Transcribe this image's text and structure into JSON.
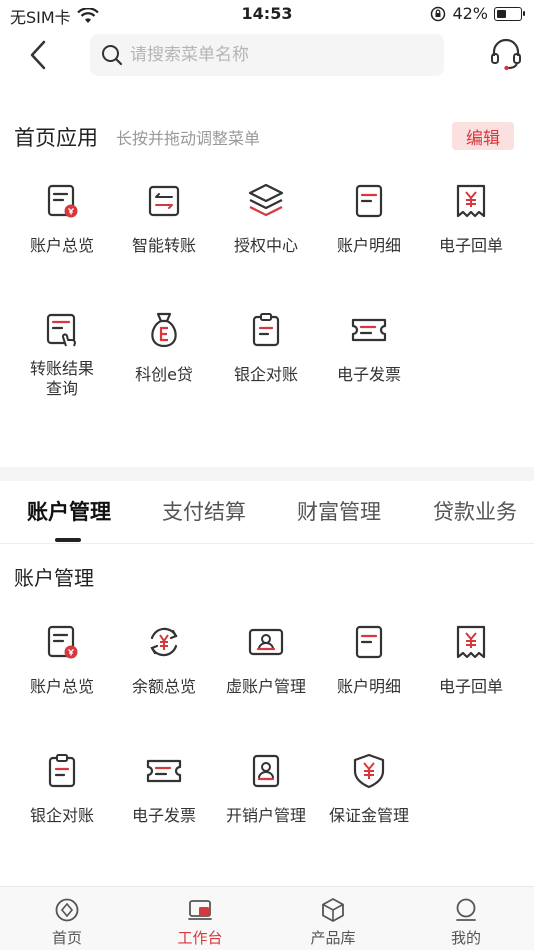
{
  "status_bar": {
    "carrier": "无SIM卡",
    "time": "14:53",
    "battery": "42%",
    "battery_level": 0.42
  },
  "search": {
    "placeholder": "请搜索菜单名称"
  },
  "home_apps": {
    "title": "首页应用",
    "hint": "长按并拖动调整菜单",
    "edit_label": "编辑",
    "items": [
      {
        "label": "账户总览",
        "icon": "account-overview-icon"
      },
      {
        "label": "智能转账",
        "icon": "smart-transfer-icon"
      },
      {
        "label": "授权中心",
        "icon": "layers-icon"
      },
      {
        "label": "账户明细",
        "icon": "account-detail-icon"
      },
      {
        "label": "电子回单",
        "icon": "receipt-icon"
      },
      {
        "label": "转账结果查询",
        "line1": "转账结果",
        "line2": "查询",
        "icon": "transfer-query-icon"
      },
      {
        "label": "科创e贷",
        "icon": "money-bag-icon"
      },
      {
        "label": "银企对账",
        "icon": "clipboard-icon"
      },
      {
        "label": "电子发票",
        "icon": "ticket-icon"
      }
    ]
  },
  "tabs": {
    "items": [
      "账户管理",
      "支付结算",
      "财富管理",
      "贷款业务"
    ],
    "active": "账户管理"
  },
  "account_mgmt": {
    "title": "账户管理",
    "items": [
      {
        "label": "账户总览",
        "icon": "account-overview-icon"
      },
      {
        "label": "余额总览",
        "icon": "balance-cycle-icon"
      },
      {
        "label": "虚账户管理",
        "icon": "virtual-account-icon"
      },
      {
        "label": "账户明细",
        "icon": "account-detail-icon"
      },
      {
        "label": "电子回单",
        "icon": "receipt-icon"
      },
      {
        "label": "银企对账",
        "icon": "clipboard-icon"
      },
      {
        "label": "电子发票",
        "icon": "ticket-icon"
      },
      {
        "label": "开销户管理",
        "icon": "id-card-icon"
      },
      {
        "label": "保证金管理",
        "icon": "shield-yen-icon"
      }
    ]
  },
  "tabbar": {
    "items": [
      {
        "label": "首页",
        "icon": "home-icon"
      },
      {
        "label": "工作台",
        "icon": "workbench-icon"
      },
      {
        "label": "产品库",
        "icon": "cube-icon"
      },
      {
        "label": "我的",
        "icon": "profile-icon"
      }
    ],
    "active": "工作台"
  },
  "colors": {
    "accent": "#d7383c",
    "edit_bg": "#fbe0e0",
    "icon_dark": "#333333"
  }
}
